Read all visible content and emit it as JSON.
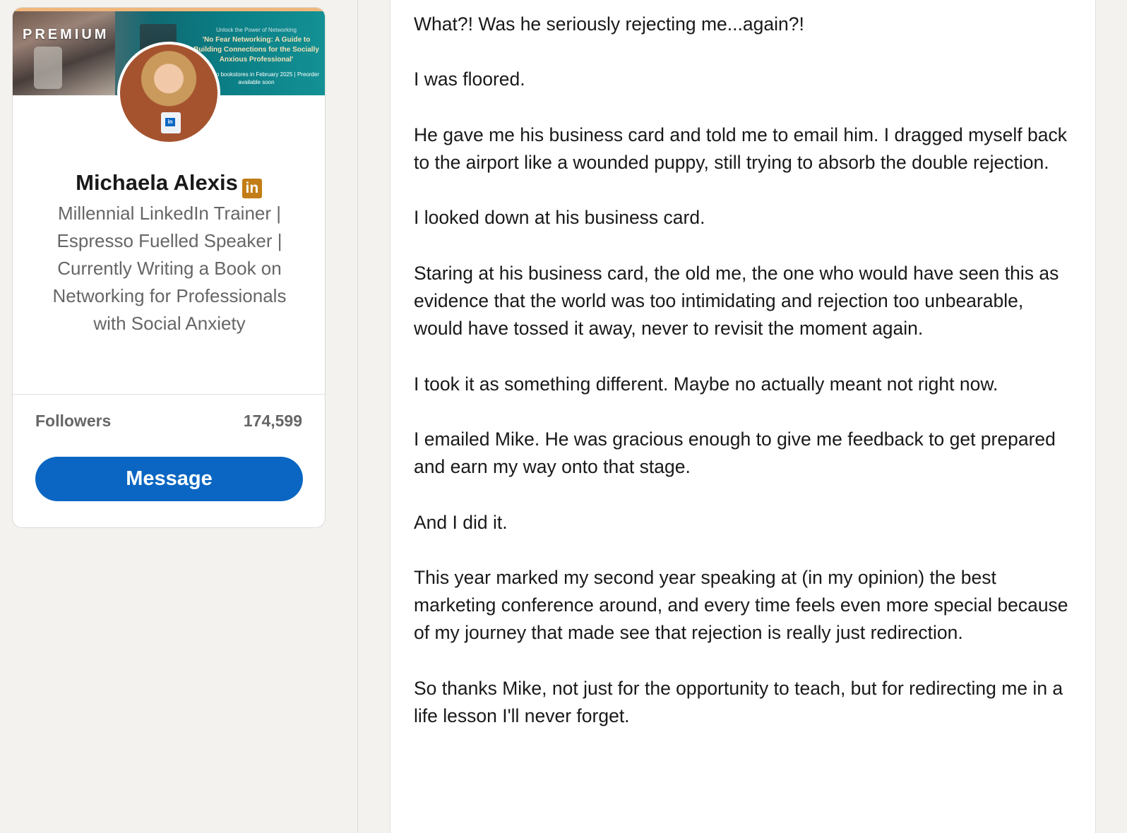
{
  "profile": {
    "banner_badge": "PREMIUM",
    "banner_small": "Unlock the Power of Networking",
    "banner_title": "'No Fear Networking: A Guide to Building Connections for the Socially Anxious Professional'",
    "banner_note": "Coming to bookstores in February 2025 | Preorder available soon",
    "name": "Michaela Alexis",
    "linkedin_badge": "in",
    "headline": "Millennial LinkedIn Trainer | Espresso Fuelled Speaker | Currently Writing a Book on Networking for Professionals with Social Anxiety",
    "followers_label": "Followers",
    "followers_count": "174,599",
    "message_label": "Message"
  },
  "article": {
    "paragraphs": [
      "What?! Was he seriously rejecting me...again?!",
      "I was floored.",
      "He gave me his business card and told me to email him. I dragged myself back to the airport like a wounded puppy, still trying to absorb the double rejection.",
      "I looked down at his business card.",
      "Staring at his business card, the old me, the one who would have seen this as evidence that the world was too intimidating and rejection too unbearable, would have tossed it away, never to revisit the moment again.",
      "I took it as something different. Maybe no actually meant not right now.",
      "I emailed Mike. He was gracious enough to give me feedback to get prepared and earn my way onto that stage.",
      "And I did it.",
      "This year marked my second year speaking at (in my opinion) the best marketing conference around, and every time feels even more special because of my journey that made see that rejection is really just redirection.",
      "So thanks Mike, not just for the opportunity to teach, but for redirecting me in a life lesson I'll never forget."
    ]
  },
  "colors": {
    "page_bg": "#f4f2ee",
    "primary_button": "#0a66c2",
    "premium_badge": "#c37d16",
    "banner_top_border": "#f0b77c"
  }
}
